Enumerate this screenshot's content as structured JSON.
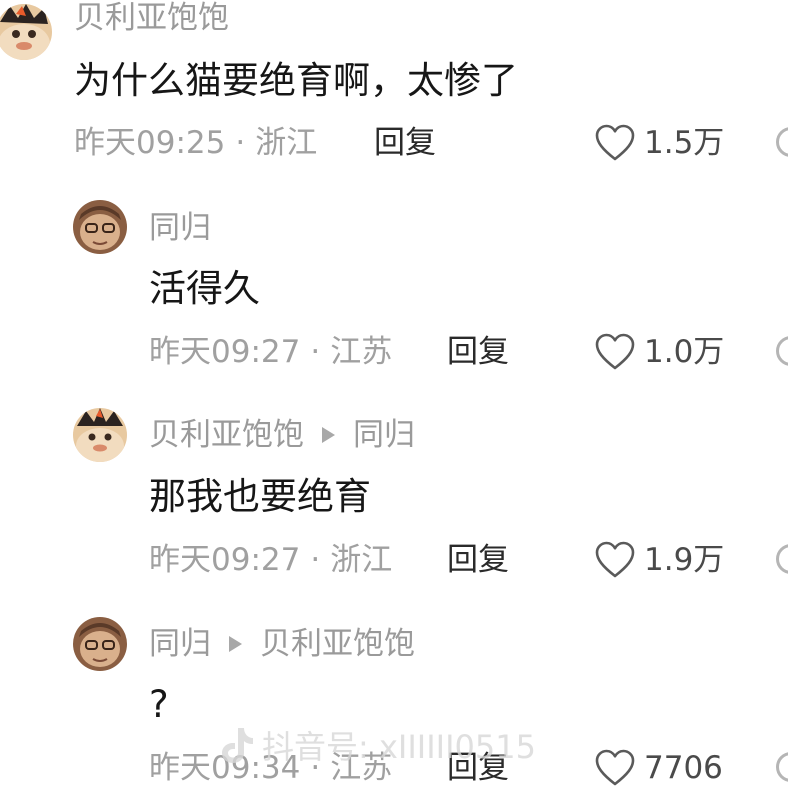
{
  "comments": [
    {
      "username": "贝利亚饱饱",
      "reply_to": "",
      "text": "为什么猫要绝育啊，太惨了",
      "time": "昨天09:25",
      "location": "浙江",
      "reply_label": "回复",
      "likes": "1.5万"
    },
    {
      "username": "同归",
      "reply_to": "",
      "text": "活得久",
      "time": "昨天09:27",
      "location": "江苏",
      "reply_label": "回复",
      "likes": "1.0万"
    },
    {
      "username": "贝利亚饱饱",
      "reply_to": "同归",
      "text": "那我也要绝育",
      "time": "昨天09:27",
      "location": "浙江",
      "reply_label": "回复",
      "likes": "1.9万"
    },
    {
      "username": "同归",
      "reply_to": "贝利亚饱饱",
      "text": "?",
      "time": "昨天09:34",
      "location": "江苏",
      "reply_label": "回复",
      "likes": "7706"
    }
  ],
  "meta_separator": "·",
  "watermark": {
    "text": "抖音号: xIIIIII0515",
    "icon": "douyin-logo-icon"
  },
  "icons": {
    "like": "heart-outline-icon",
    "more": "more-options-icon",
    "reply_arrow": "play-triangle-icon"
  },
  "colors": {
    "username": "#9a9a9a",
    "text": "#161616",
    "meta": "#a0a0a0",
    "reply": "#2a2a2a"
  }
}
